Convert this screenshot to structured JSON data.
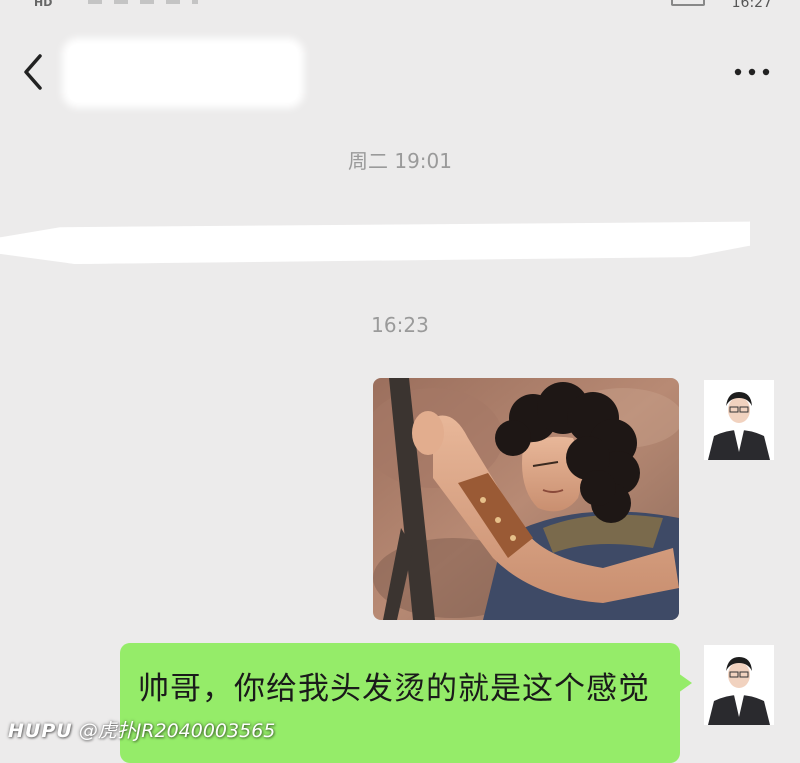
{
  "status_bar": {
    "hd_label": "HD",
    "time": "16:27"
  },
  "header": {
    "back_icon": "chevron-left-icon",
    "more_icon": "more-dots-icon"
  },
  "messages": {
    "timestamp_1": "周二 19:01",
    "timestamp_2": "16:23",
    "image_message": "anime-character-image",
    "text_message": "帅哥，你给我头发烫的就是这个感觉"
  },
  "watermark": {
    "brand": "HUPU",
    "handle": "@虎扑JR2040003565"
  },
  "colors": {
    "chat_background": "#ecebeb",
    "sent_bubble": "#95ec69",
    "timestamp_text": "#9a9a9a"
  }
}
